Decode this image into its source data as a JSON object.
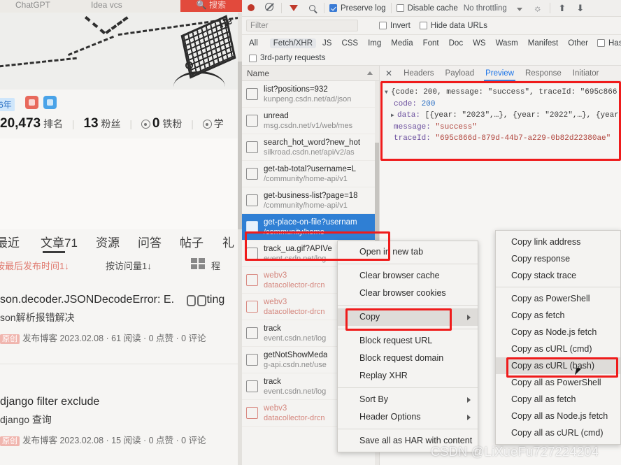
{
  "page": {
    "topbar": {
      "tab1": "ChatGPT",
      "tab2": "Idea vcs",
      "button": "🔍 搜索"
    },
    "banner_note": "He",
    "badges": {
      "year": "6年",
      "icon_red": "medal-icon",
      "icon_blue": "camera-icon"
    },
    "counters": {
      "rank_value": "20,473",
      "rank_label": "排名",
      "fans_value": "13",
      "fans_label": "粉丝",
      "iron_value": "0",
      "iron_label": "铁粉",
      "extra_label": "学"
    },
    "nav_tabs": [
      "最近",
      "文章71",
      "资源",
      "问答",
      "帖子",
      "礼"
    ],
    "sort_row": {
      "by_time": "按最后发布时间1↓",
      "by_views": "按访问量1↓",
      "layout_label": "程"
    },
    "posts": [
      {
        "title": "son.decoder.JSONDecodeError: E.",
        "title_tail": "ting",
        "subtitle": "son解析报错解决",
        "badge": "原创",
        "meta": "发布博客 2023.02.08 · 61 阅读 · 0 点赞 · 0 评论"
      },
      {
        "title": "django filter exclude",
        "subtitle": "django 查询",
        "badge": "原创",
        "meta": "发布博客 2023.02.08 · 15 阅读 · 0 点赞 · 0 评论"
      }
    ]
  },
  "devtools": {
    "toolbar": {
      "record_icon": "record-icon",
      "clear_icon": "clear-icon",
      "filter_icon": "filter-icon",
      "search_icon": "search-icon",
      "preserve_log": "Preserve log",
      "preserve_log_checked": true,
      "disable_cache": "Disable cache",
      "disable_cache_checked": false,
      "throttling": "No throttling",
      "caret_icon": "chevron-down-icon",
      "wifi_icon": "network-conditions-icon",
      "import_icon": "import-har-icon",
      "export_icon": "export-har-icon"
    },
    "filterbar": {
      "placeholder": "Filter",
      "value": "",
      "invert": "Invert",
      "hide_data_urls": "Hide data URLs"
    },
    "types": [
      "All",
      "Fetch/XHR",
      "JS",
      "CSS",
      "Img",
      "Media",
      "Font",
      "Doc",
      "WS",
      "Wasm",
      "Manifest",
      "Other"
    ],
    "selected_type": "Fetch/XHR",
    "has_blocked": "Has blocked",
    "third_party": "3rd-party requests",
    "request_list": {
      "column_header": "Name",
      "rows": [
        {
          "name": "list?positions=932",
          "url": "kunpeng.csdn.net/ad/json",
          "state": "normal"
        },
        {
          "name": "unread",
          "url": "msg.csdn.net/v1/web/mes",
          "state": "normal"
        },
        {
          "name": "search_hot_word?new_hot",
          "url": "silkroad.csdn.net/api/v2/as",
          "state": "normal"
        },
        {
          "name": "get-tab-total?username=L",
          "url": "/community/home-api/v1",
          "state": "normal"
        },
        {
          "name": "get-business-list?page=18",
          "url": "/community/home-api/v1",
          "state": "normal"
        },
        {
          "name": "get-place-on-file?usernam",
          "url": "/community/home",
          "state": "selected"
        },
        {
          "name": "track_ua.gif?APIVe",
          "url": "event.csdn.net/log",
          "state": "normal"
        },
        {
          "name": "webv3",
          "url": "datacollector-drcn",
          "state": "error"
        },
        {
          "name": "webv3",
          "url": "datacollector-drcn",
          "state": "error"
        },
        {
          "name": "track",
          "url": "event.csdn.net/log",
          "state": "normal"
        },
        {
          "name": "getNotShowMeda",
          "url": "g-api.csdn.net/use",
          "state": "normal"
        },
        {
          "name": "track",
          "url": "event.csdn.net/log",
          "state": "normal"
        },
        {
          "name": "webv3",
          "url": "datacollector-drcn",
          "state": "error"
        }
      ]
    },
    "response_panel": {
      "tabs": [
        "Headers",
        "Payload",
        "Preview",
        "Response",
        "Initiator"
      ],
      "selected_tab": "Preview",
      "close_icon": "close-icon",
      "preview": {
        "root_line": "{code: 200, message: \"success\", traceId: \"695c866",
        "lines": [
          {
            "key": "code:",
            "value": "200",
            "type": "number",
            "expandable": false
          },
          {
            "key": "data:",
            "value": "[{year: \"2023\",…}, {year: \"2022\",…}, {year",
            "type": "array",
            "expandable": true
          },
          {
            "key": "message:",
            "value": "\"success\"",
            "type": "string",
            "expandable": false
          },
          {
            "key": "traceId:",
            "value": "\"695c866d-879d-44b7-a229-0b82d22380ae\"",
            "type": "string",
            "expandable": false
          }
        ]
      }
    },
    "context_menu": {
      "items": [
        {
          "label": "Open in new tab",
          "submenu": false,
          "highlighted": false
        },
        {
          "separator": true
        },
        {
          "label": "Clear browser cache",
          "submenu": false,
          "highlighted": false
        },
        {
          "label": "Clear browser cookies",
          "submenu": false,
          "highlighted": false
        },
        {
          "separator": true
        },
        {
          "label": "Copy",
          "submenu": true,
          "highlighted": true
        },
        {
          "separator": true
        },
        {
          "label": "Block request URL",
          "submenu": false,
          "highlighted": false
        },
        {
          "label": "Block request domain",
          "submenu": false,
          "highlighted": false
        },
        {
          "label": "Replay XHR",
          "submenu": false,
          "highlighted": false
        },
        {
          "separator": true
        },
        {
          "label": "Sort By",
          "submenu": true,
          "highlighted": false
        },
        {
          "label": "Header Options",
          "submenu": true,
          "highlighted": false
        },
        {
          "separator": true
        },
        {
          "label": "Save all as HAR with content",
          "submenu": false,
          "highlighted": false
        }
      ]
    },
    "copy_submenu": {
      "items": [
        {
          "label": "Copy link address",
          "highlighted": false
        },
        {
          "label": "Copy response",
          "highlighted": false
        },
        {
          "label": "Copy stack trace",
          "highlighted": false
        },
        {
          "separator": true
        },
        {
          "label": "Copy as PowerShell",
          "highlighted": false
        },
        {
          "label": "Copy as fetch",
          "highlighted": false
        },
        {
          "label": "Copy as Node.js fetch",
          "highlighted": false
        },
        {
          "label": "Copy as cURL (cmd)",
          "highlighted": false
        },
        {
          "label": "Copy as cURL (bash)",
          "highlighted": true
        },
        {
          "label": "Copy all as PowerShell",
          "highlighted": false
        },
        {
          "label": "Copy all as fetch",
          "highlighted": false
        },
        {
          "label": "Copy all as Node.js fetch",
          "highlighted": false
        },
        {
          "label": "Copy all as cURL (cmd)",
          "highlighted": false
        }
      ]
    }
  },
  "annotations": {
    "highlight_color": "#ef1b1b",
    "watermark": "CSDN @LiXueFu727224204"
  }
}
